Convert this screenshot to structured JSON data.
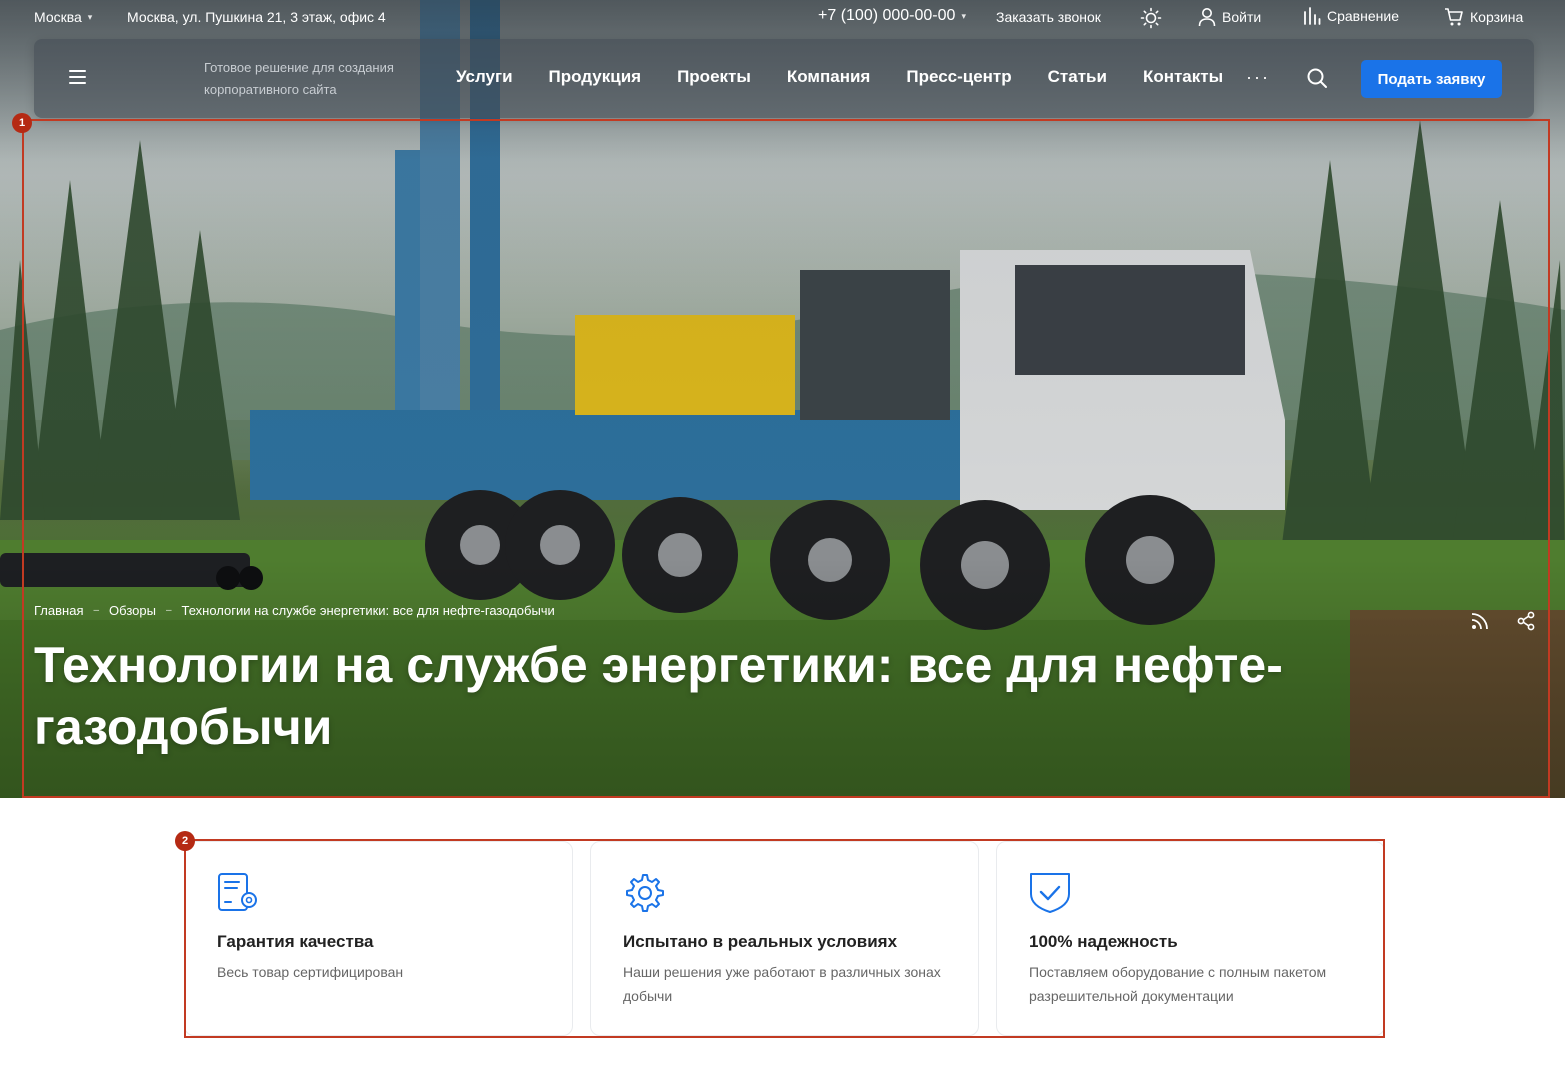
{
  "topbar": {
    "city": "Москва",
    "address": "Москва, ул. Пушкина 21, 3 этаж, офис 4",
    "phone": "+7 (100) 000-00-00",
    "callback": "Заказать звонок",
    "login": "Войти",
    "compare": "Сравнение",
    "cart": "Корзина"
  },
  "nav": {
    "tagline": "Готовое решение для создания корпоративного сайта",
    "items": [
      "Услуги",
      "Продукция",
      "Проекты",
      "Компания",
      "Пресс-центр",
      "Статьи",
      "Контакты"
    ],
    "more": "···",
    "cta": "Подать заявку"
  },
  "breadcrumb": [
    "Главная",
    "Обзоры",
    "Технологии на службе энергетики: все для нефте-газодобычи"
  ],
  "title": "Технологии на службе энергетики: все для нефте-газодобычи",
  "features": [
    {
      "icon": "certificate-icon",
      "title": "Гарантия качества",
      "text": "Весь товар сертифицирован"
    },
    {
      "icon": "gear-icon",
      "title": "Испытано в реальных условиях",
      "text": "Наши решения уже работают в различных зонах добычи"
    },
    {
      "icon": "shield-check-icon",
      "title": "100% надежность",
      "text": "Поставляем оборудование с полным пакетом разрешительной документации"
    }
  ],
  "badges": [
    "1",
    "2"
  ],
  "colors": {
    "accent": "#1a73e8",
    "annotation": "#c23a22"
  }
}
